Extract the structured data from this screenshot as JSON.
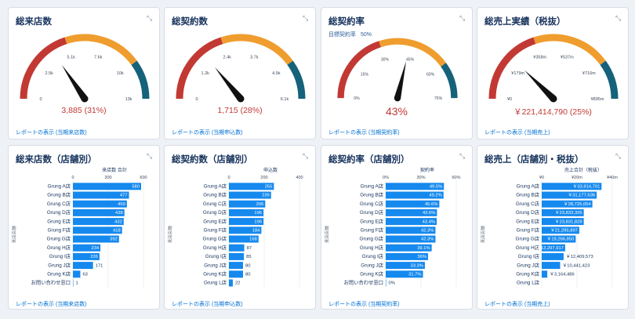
{
  "cards_top": [
    {
      "title": "総来店数",
      "ticks": [
        "0",
        "2.5k",
        "5.1k",
        "7.6k",
        "10k",
        "13k"
      ],
      "gauge_max": 12500,
      "value_num": 3885,
      "value_text": "3,885 (31%)",
      "link": "レポートの表示 (当期来店数)"
    },
    {
      "title": "総契約数",
      "ticks": [
        "0",
        "1.2k",
        "2.4k",
        "3.7k",
        "4.9k",
        "6.1k"
      ],
      "gauge_max": 6100,
      "value_num": 1715,
      "value_text": "1,715 (28%)",
      "link": "レポートの表示 (当期申込数)"
    },
    {
      "title": "総契約率",
      "subtitle_label": "目標契約率",
      "subtitle_value": "50%",
      "ticks": [
        "0%",
        "15%",
        "30%",
        "45%",
        "60%",
        "75%"
      ],
      "gauge_max": 75,
      "value_num": 43,
      "value_text": "43%",
      "link": "レポートの表示 (当期契約率)"
    },
    {
      "title": "総売上実績（税抜）",
      "ticks": [
        "¥0",
        "¥179m",
        "¥358m",
        "¥537m",
        "¥716m",
        "¥895m"
      ],
      "gauge_max": 895,
      "value_num": 221.4,
      "value_text": "￥221,414,790 (25%)",
      "link": "レポートの表示 (当期売上)"
    }
  ],
  "gauge_colors": {
    "red": "#c23934",
    "orange": "#ef9d2e",
    "teal": "#15627a",
    "needle": "#111111"
  },
  "bar_color": "#1589ee",
  "cards_bottom": [
    {
      "title": "総来店数（店舗別）",
      "axis_title": "来店数 合計",
      "axis_ticks": [
        "0",
        "300",
        "600"
      ],
      "axis_max": 600,
      "y_axis_label": "来店店舗",
      "link": "レポートの表示 (当期来店数)",
      "chart_data": {
        "type": "bar",
        "categories": [
          "Grung A店",
          "Grung B店",
          "Grung C店",
          "Grung D店",
          "Grung E店",
          "Grung F店",
          "Grung G店",
          "Grung H店",
          "Grung I店",
          "Grung J店",
          "Grung K店",
          "お問い合わせ窓口"
        ],
        "values": [
          580,
          477,
          459,
          438,
          432,
          418,
          392,
          234,
          226,
          171,
          63,
          1
        ],
        "labels": [
          "580",
          "477",
          "459",
          "438",
          "432",
          "418",
          "392",
          "234",
          "226",
          "171",
          "63",
          "1"
        ]
      }
    },
    {
      "title": "総契約数（店舗別）",
      "axis_title": "申込数",
      "axis_ticks": [
        "0",
        "200",
        "400"
      ],
      "axis_max": 400,
      "y_axis_label": "来店店舗",
      "link": "レポートの表示 (当期申込数)",
      "chart_data": {
        "type": "bar",
        "categories": [
          "Grung A店",
          "Grung B店",
          "Grung C店",
          "Grung D店",
          "Grung E店",
          "Grung F店",
          "Grung G店",
          "Grung H店",
          "Grung I店",
          "Grung J店",
          "Grung K店",
          "Grung L店"
        ],
        "values": [
          255,
          239,
          206,
          196,
          196,
          184,
          168,
          87,
          85,
          80,
          80,
          22
        ],
        "labels": [
          "255",
          "239",
          "206",
          "196",
          "196",
          "184",
          "168",
          "87",
          "85",
          "80",
          "80",
          "22"
        ]
      }
    },
    {
      "title": "総契約率（店舗別）",
      "axis_title": "契約率",
      "axis_ticks": [
        "0%",
        "30%",
        "60%"
      ],
      "axis_max": 60,
      "y_axis_label": "来店店舗",
      "link": "レポートの表示 (当期契約率)",
      "chart_data": {
        "type": "bar",
        "categories": [
          "Grung A店",
          "Grung B店",
          "Grung C店",
          "Grung D店",
          "Grung E店",
          "Grung F店",
          "Grung G店",
          "Grung H店",
          "Grung I店",
          "Grung J店",
          "Grung K店",
          "お問い合わせ窓口"
        ],
        "values": [
          49.5,
          49.2,
          45.6,
          43.6,
          43.4,
          42.3,
          42.3,
          39.1,
          36,
          33.3,
          31.7,
          0
        ],
        "labels": [
          "49.5%",
          "49.2%",
          "45.6%",
          "43.6%",
          "43.4%",
          "42.3%",
          "42.3%",
          "39.1%",
          "36%",
          "33.3%",
          "31.7%",
          "0%"
        ]
      }
    },
    {
      "title": "総売上（店舗別・税抜）",
      "axis_title": "売上合計（税抜）",
      "axis_ticks": [
        "¥0",
        "¥20m",
        "¥40m"
      ],
      "axis_max": 40,
      "y_axis_label": "来店店舗",
      "link": "レポートの表示 (当期売上)",
      "chart_data": {
        "type": "bar",
        "categories": [
          "Grung A店",
          "Grung B店",
          "Grung C店",
          "Grung D店",
          "Grung E店",
          "Grung F店",
          "Grung G店",
          "Grung H店",
          "Grung I店",
          "Grung J店",
          "Grung K店",
          "Grung L店"
        ],
        "values": [
          33.914701,
          31.177636,
          28.725054,
          23.833335,
          23.831828,
          21.295897,
          19.26685,
          13.297917,
          12.409573,
          10.441423,
          3.164486
        ],
        "labels": [
          "￥33,914,701",
          "￥31,177,636",
          "￥28,725,054",
          "￥23,833,335",
          "￥23,831,828",
          "￥21,295,897",
          "￥19,266,850",
          "￥13,297,917",
          "￥12,409,573",
          "￥10,441,423",
          "￥3,164,486"
        ]
      }
    }
  ]
}
